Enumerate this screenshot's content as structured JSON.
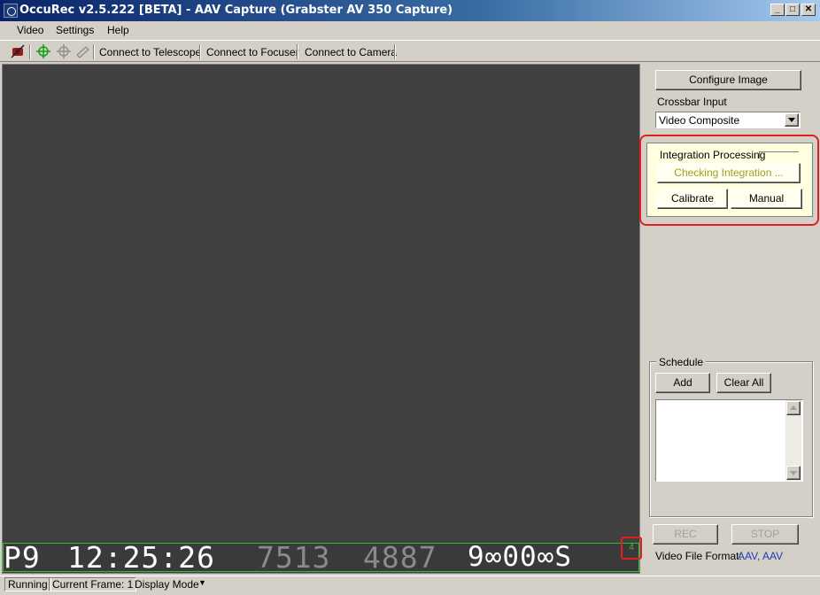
{
  "window": {
    "title": "OccuRec v2.5.222 [BETA] - AAV Capture (Grabster AV 350 Capture)",
    "controls": {
      "minimize": "_",
      "maximize": "□",
      "close": "✕"
    }
  },
  "menu": {
    "items": [
      "Video",
      "Settings",
      "Help"
    ]
  },
  "toolbar": {
    "icons": [
      "camera-off-icon",
      "crosshair-green-icon",
      "crosshair-gray-icon",
      "telescope-icon"
    ],
    "connect_telescope": "Connect to Telescope",
    "connect_focuser": "Connect to Focuser",
    "connect_camera": "Connect to Camera"
  },
  "video": {
    "osd": {
      "prefix": "P9",
      "time": "12:25:26",
      "field1": "7513",
      "field2": "4887",
      "field3": "9∞00∞S"
    },
    "frame_counter": "4"
  },
  "panel": {
    "configure_image": "Configure Image",
    "crossbar_label": "Crossbar Input",
    "crossbar_value": "Video Composite",
    "integration": {
      "label": "Integration Processing",
      "checking": "Checking Integration ...",
      "calibrate": "Calibrate",
      "manual": "Manual"
    },
    "schedule": {
      "title": "Schedule",
      "add": "Add",
      "clear_all": "Clear All"
    },
    "rec": "REC",
    "stop": "STOP",
    "video_file_format_label": "Video File Format:",
    "video_file_format_value": "AAV, AAV"
  },
  "statusbar": {
    "running": "Running",
    "current_frame": "Current Frame: 1",
    "display_mode": "Display Mode",
    "display_mode_arrow": "▼"
  },
  "colors": {
    "titlebar_start": "#0a246a",
    "osd_green": "#2ec02e",
    "highlight_red": "#e02020",
    "link_blue": "#1a3fb0"
  }
}
